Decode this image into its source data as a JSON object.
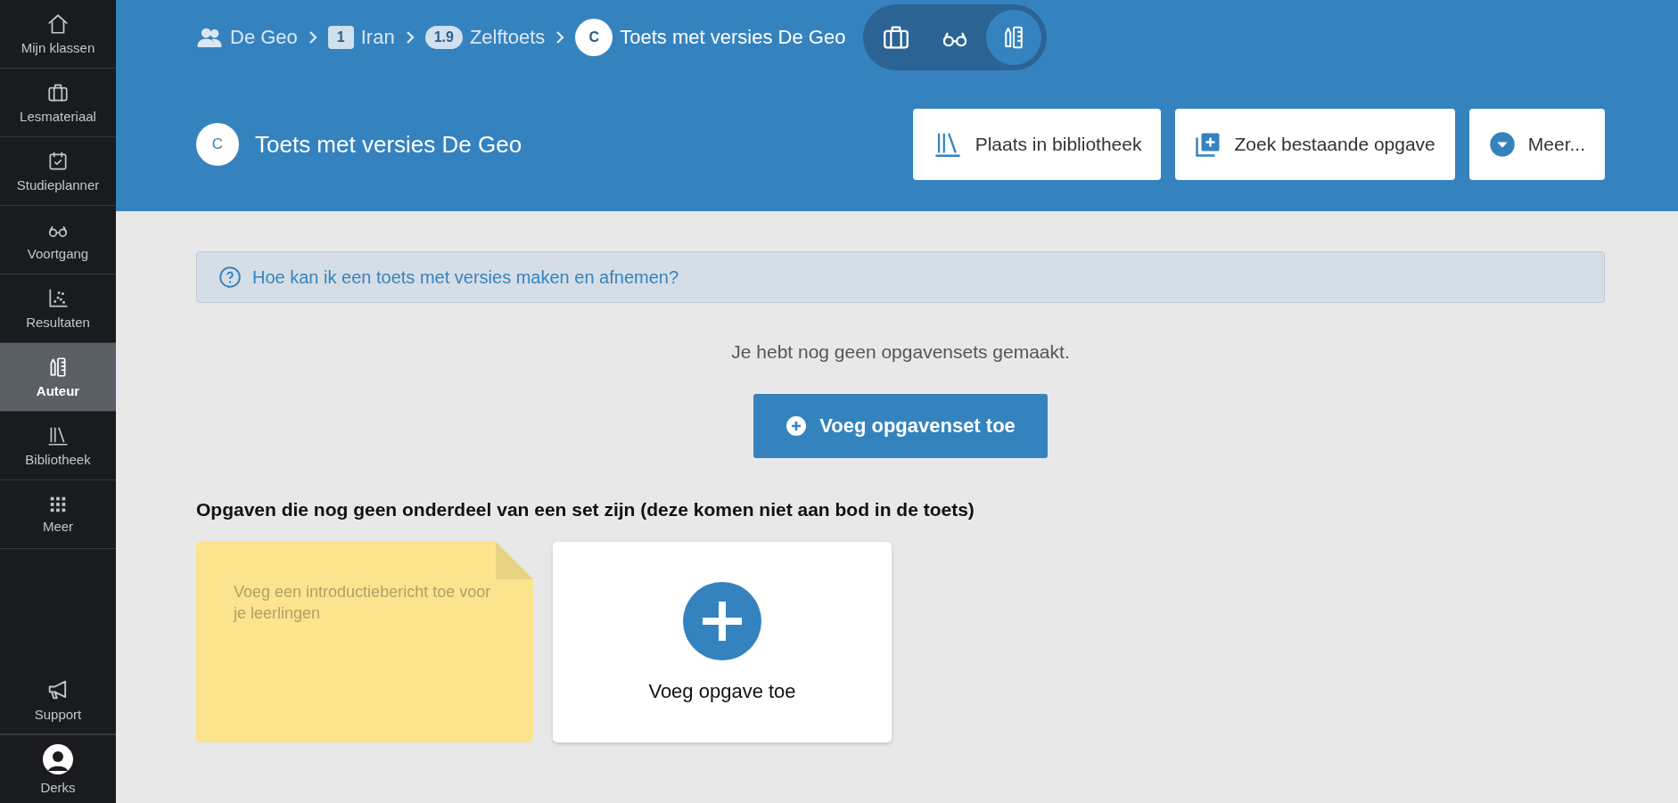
{
  "sidebar": {
    "items": [
      {
        "label": "Mijn klassen",
        "selected": false
      },
      {
        "label": "Lesmateriaal",
        "selected": false
      },
      {
        "label": "Studieplanner",
        "selected": false
      },
      {
        "label": "Voortgang",
        "selected": false
      },
      {
        "label": "Resultaten",
        "selected": false
      },
      {
        "label": "Auteur",
        "selected": true
      },
      {
        "label": "Bibliotheek",
        "selected": false
      },
      {
        "label": "Meer",
        "selected": false
      }
    ],
    "bottom_items": [
      {
        "label": "Support"
      },
      {
        "label": "Derks"
      }
    ]
  },
  "breadcrumb": [
    {
      "label": "De Geo"
    },
    {
      "badge": "1",
      "label": "Iran"
    },
    {
      "badge": "1.9",
      "label": "Zelftoets"
    },
    {
      "badge": "C",
      "label": "Toets met versies De Geo"
    }
  ],
  "mode_switch": [
    {
      "selected": false
    },
    {
      "selected": false
    },
    {
      "selected": true
    }
  ],
  "header": {
    "badge": "C",
    "title": "Toets met versies De Geo",
    "buttons": [
      {
        "label": "Plaats in bibliotheek"
      },
      {
        "label": "Zoek bestaande opgave"
      },
      {
        "label": "Meer..."
      }
    ]
  },
  "help_link": "Hoe kan ik een toets met versies maken en afnemen?",
  "empty_message": "Je hebt nog geen opgavensets gemaakt.",
  "add_set_button": "Voeg opgavenset toe",
  "section_heading": "Opgaven die nog geen onderdeel van een set zijn (deze komen niet aan bod in de toets)",
  "intro_note": {
    "placeholder": "Voeg een introductiebericht toe voor je leerlingen"
  },
  "add_task_card": {
    "label": "Voeg opgave toe"
  }
}
